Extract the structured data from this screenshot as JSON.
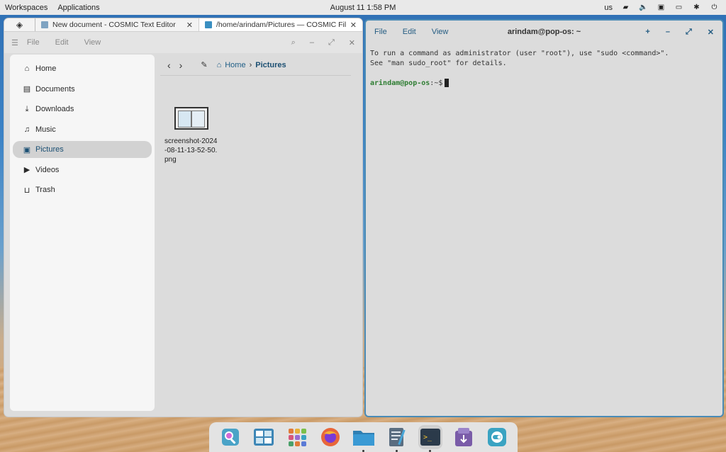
{
  "top_panel": {
    "workspaces": "Workspaces",
    "applications": "Applications",
    "datetime": "August 11 1:58 PM",
    "keyboard_layout": "us",
    "tray_icons": [
      "network-icon",
      "volume-icon",
      "notifications-icon",
      "battery-icon",
      "bluetooth-icon",
      "power-icon"
    ]
  },
  "files_window": {
    "tabs": [
      {
        "label": "New document - COSMIC Text Editor",
        "icon": "text-editor-icon"
      },
      {
        "label": "/home/arindam/Pictures — COSMIC Files",
        "icon": "folder-icon"
      }
    ],
    "menu": {
      "file": "File",
      "edit": "Edit",
      "view": "View"
    },
    "sidebar": [
      {
        "label": "Home",
        "icon": "home-icon"
      },
      {
        "label": "Documents",
        "icon": "documents-icon"
      },
      {
        "label": "Downloads",
        "icon": "downloads-icon"
      },
      {
        "label": "Music",
        "icon": "music-icon"
      },
      {
        "label": "Pictures",
        "icon": "pictures-icon",
        "active": true
      },
      {
        "label": "Videos",
        "icon": "videos-icon"
      },
      {
        "label": "Trash",
        "icon": "trash-icon"
      }
    ],
    "breadcrumb": {
      "home": "Home",
      "current": "Pictures"
    },
    "files": [
      {
        "name": "screenshot-2024-08-11-13-52-50.png"
      }
    ]
  },
  "terminal_window": {
    "title": "arindam@pop-os: ~",
    "menu": {
      "file": "File",
      "edit": "Edit",
      "view": "View"
    },
    "lines": [
      "To run a command as administrator (user \"root\"), use \"sudo <command>\".",
      "See \"man sudo_root\" for details."
    ],
    "prompt_user": "arindam@pop-os",
    "prompt_rest": ":~$"
  },
  "dock": {
    "apps": [
      {
        "name": "launcher-icon",
        "color": "#4aa3c7"
      },
      {
        "name": "workspaces-icon",
        "color": "#3d86b6"
      },
      {
        "name": "app-grid-icon",
        "color": "#e07b39"
      },
      {
        "name": "firefox-icon",
        "color": "#e8663a"
      },
      {
        "name": "files-icon",
        "color": "#3a8fc1"
      },
      {
        "name": "text-editor-icon",
        "color": "#5a6d80"
      },
      {
        "name": "terminal-icon",
        "color": "#2b3a4a"
      },
      {
        "name": "store-icon",
        "color": "#7a5ca8"
      },
      {
        "name": "settings-icon",
        "color": "#3aa3c2"
      }
    ]
  }
}
